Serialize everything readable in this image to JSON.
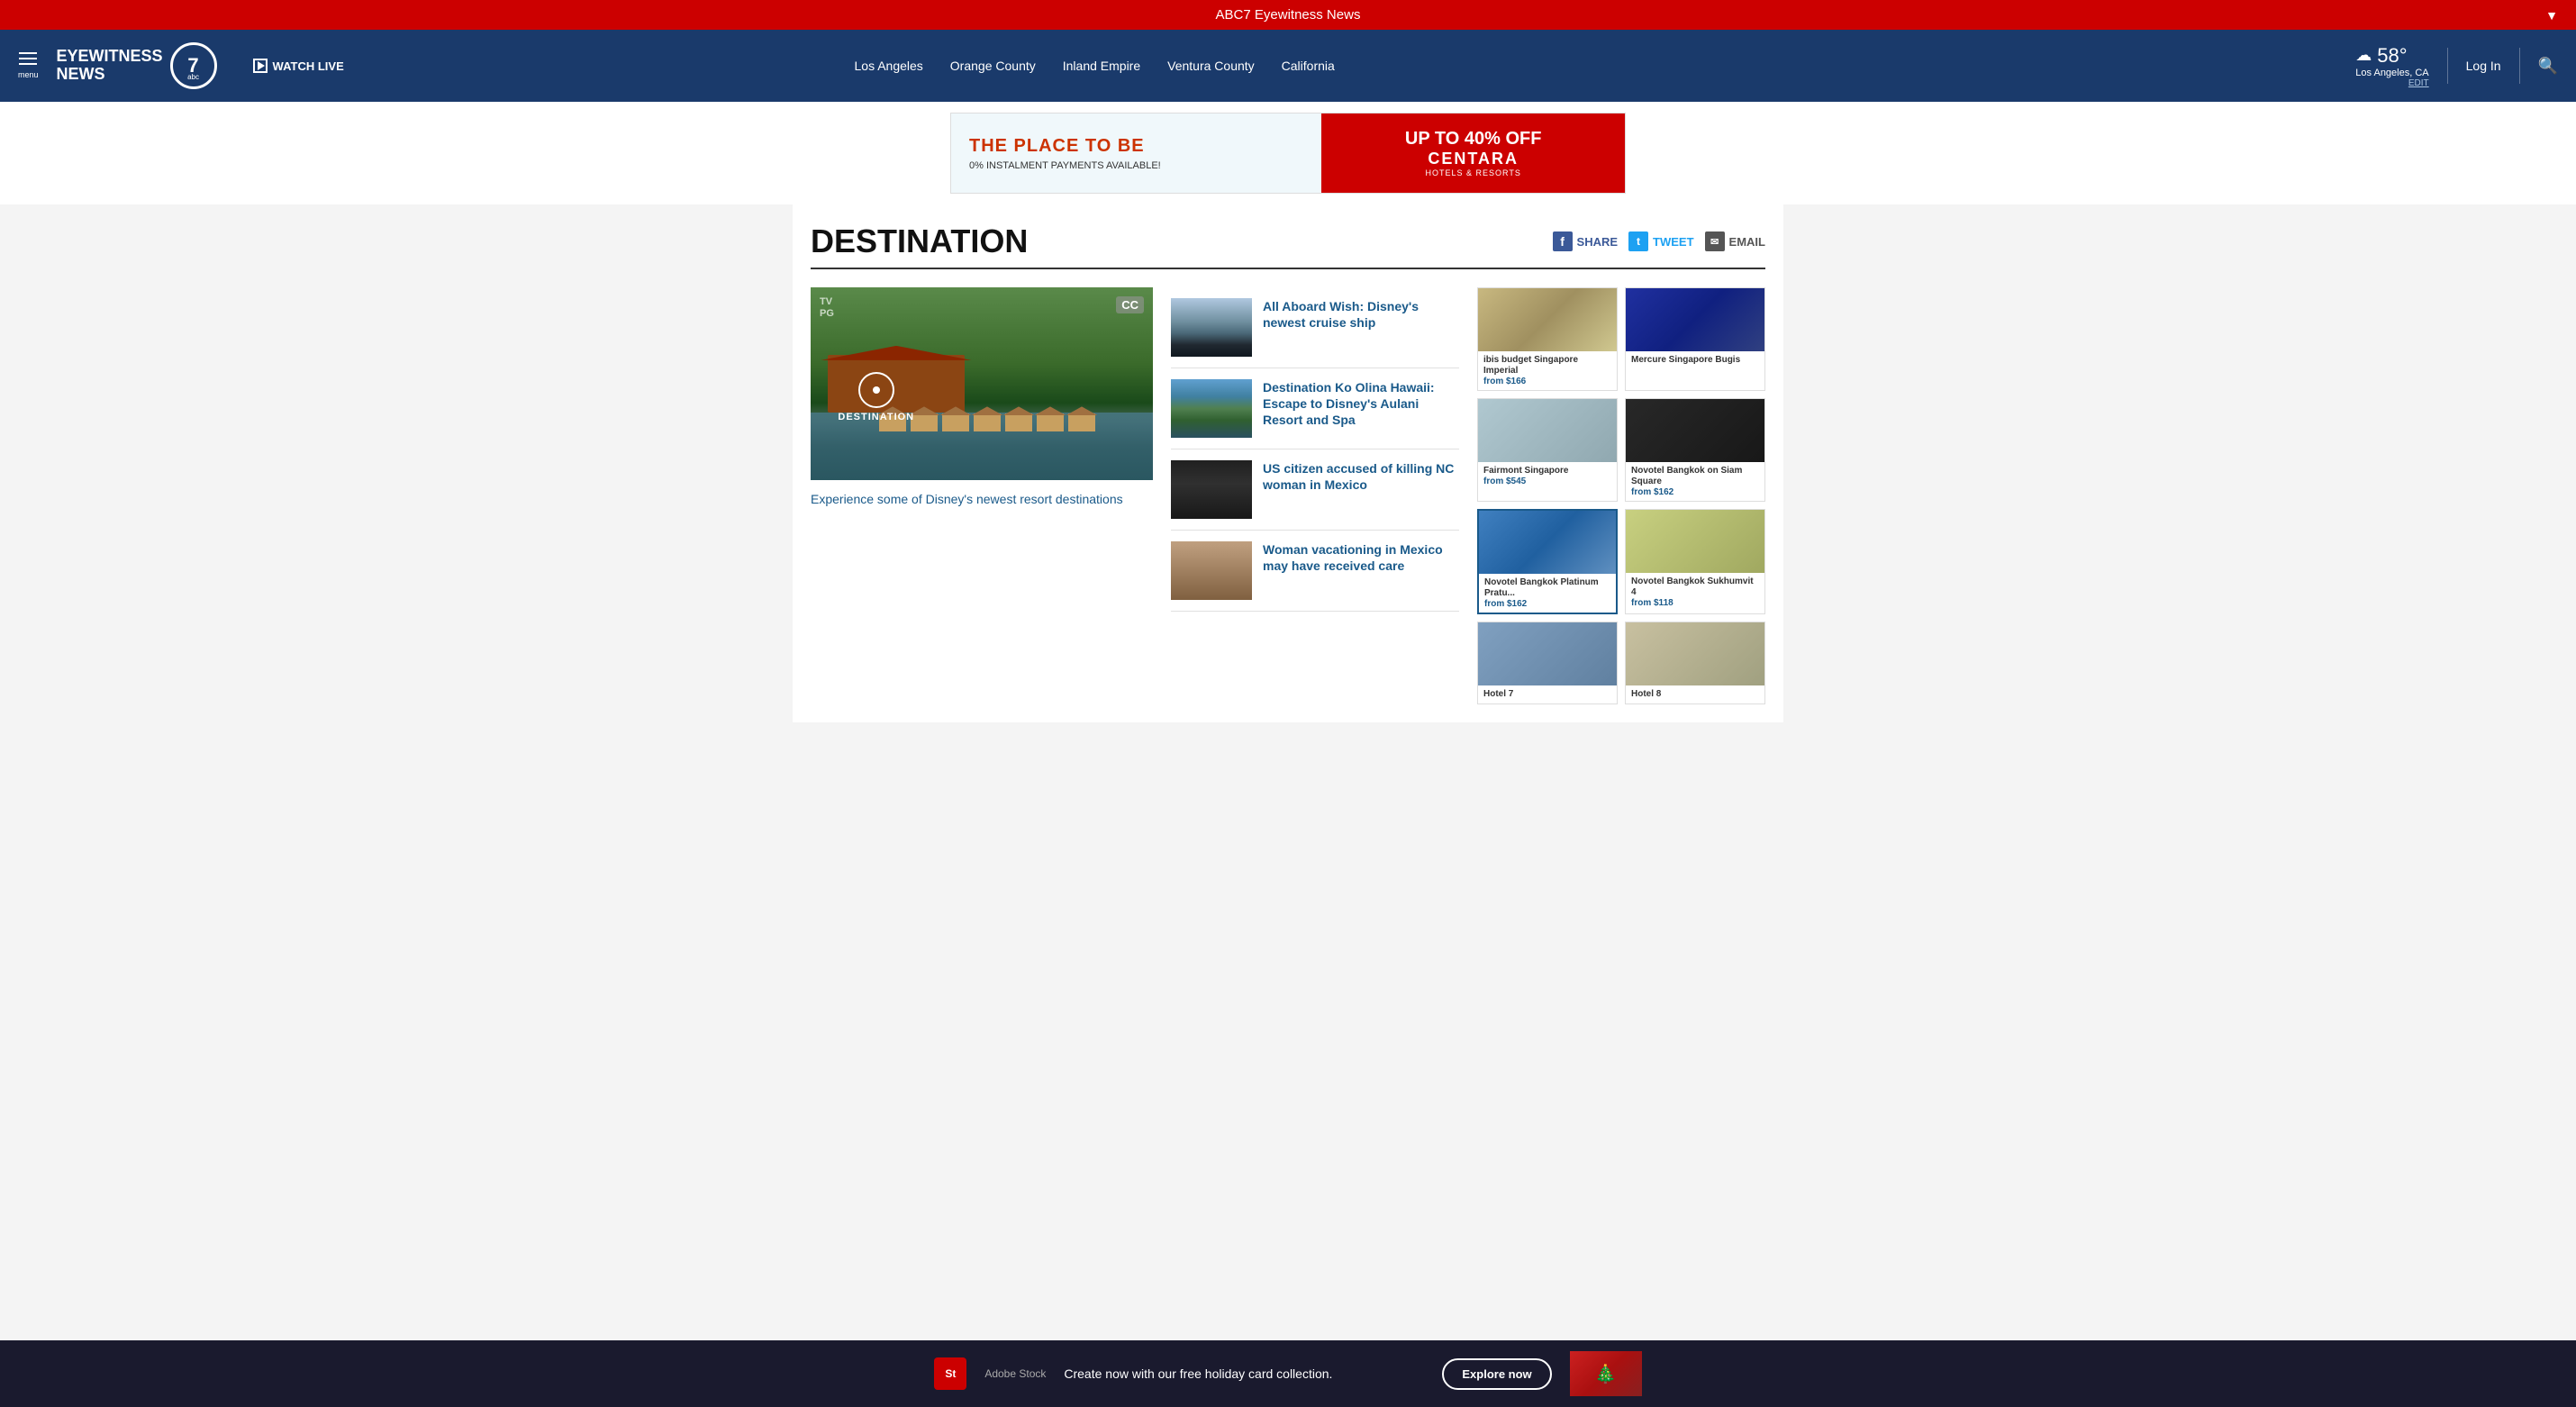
{
  "topBar": {
    "label": "ABC7 Eyewitness News",
    "arrowIcon": "▼"
  },
  "navbar": {
    "menuLabel": "menu",
    "logoLine1": "EYEWITNESS",
    "logoLine2": "NEWS",
    "logoNumber": "7",
    "logoAbc": "abc",
    "watchLive": "WATCH LIVE",
    "navLinks": [
      {
        "id": "los-angeles",
        "label": "Los Angeles"
      },
      {
        "id": "orange-county",
        "label": "Orange County"
      },
      {
        "id": "inland-empire",
        "label": "Inland Empire"
      },
      {
        "id": "ventura-county",
        "label": "Ventura County"
      },
      {
        "id": "california",
        "label": "California"
      }
    ],
    "weather": {
      "cloudIcon": "☁",
      "temp": "58°",
      "location": "Los Angeles, CA",
      "editLabel": "EDIT"
    },
    "loginLabel": "Log In",
    "searchIcon": "🔍"
  },
  "ad": {
    "leftTitle": "THE PLACE TO BE",
    "leftSubtitle": "0% INSTALMENT PAYMENTS AVAILABLE!",
    "rightDiscount": "UP TO 40% OFF",
    "rightBrand": "CENTARA",
    "rightBrandSub": "HOTELS & RESORTS"
  },
  "page": {
    "title": "DESTINATION",
    "share": {
      "facebookLabel": "SHARE",
      "twitterLabel": "TWEET",
      "emailLabel": "EMAIL"
    }
  },
  "mainVideo": {
    "tvRating": "TV\nPG",
    "ccBadge": "CC",
    "pinLabel": "DESTINATION",
    "caption": "Experience some of Disney's newest resort destinations"
  },
  "sideArticles": [
    {
      "id": "cruise",
      "thumbClass": "thumb-cruise",
      "title": "All Aboard Wish: Disney's newest cruise ship"
    },
    {
      "id": "hawaii",
      "thumbClass": "thumb-hawaii",
      "title": "Destination Ko Olina Hawaii: Escape to Disney's Aulani Resort and Spa"
    },
    {
      "id": "nc-mexico",
      "thumbClass": "thumb-nc",
      "title": "US citizen accused of killing NC woman in Mexico"
    },
    {
      "id": "mexico-care",
      "thumbClass": "thumb-mexico",
      "title": "Woman vacationing in Mexico may have received care"
    }
  ],
  "hotels": [
    {
      "id": "ibis-singapore",
      "imgClass": "hotel-img-1",
      "name": "ibis budget Singapore Imperial",
      "price": "from $166",
      "highlight": false
    },
    {
      "id": "mercure-bugis",
      "imgClass": "hotel-img-2",
      "name": "Mercure Singapore Bugis",
      "price": "",
      "highlight": false
    },
    {
      "id": "fairmont-singapore",
      "imgClass": "hotel-img-3",
      "name": "Fairmont Singapore",
      "price": "from $545",
      "highlight": false
    },
    {
      "id": "novotel-bangkok-siam",
      "imgClass": "hotel-img-4",
      "name": "Novotel Bangkok on Siam Square",
      "price": "from $162",
      "highlight": false
    },
    {
      "id": "novotel-bangkok-platinum",
      "imgClass": "hotel-img-5",
      "name": "Novotel Bangkok Platinum Pratu...",
      "price": "from $162",
      "highlight": true
    },
    {
      "id": "novotel-bangkok-sukhumvit",
      "imgClass": "hotel-img-6",
      "name": "Novotel Bangkok Sukhumvit 4",
      "price": "from $118",
      "highlight": false
    },
    {
      "id": "hotel-7",
      "imgClass": "hotel-img-7",
      "name": "Hotel 7",
      "price": "",
      "highlight": false
    },
    {
      "id": "hotel-8",
      "imgClass": "hotel-img-8",
      "name": "Hotel 8",
      "price": "",
      "highlight": false
    }
  ],
  "bottomAd": {
    "adobeIconLabel": "St",
    "adobeBrand": "Adobe Stock",
    "ctaText": "Create now with our free holiday card collection.",
    "exploreLabel": "Explore now"
  }
}
